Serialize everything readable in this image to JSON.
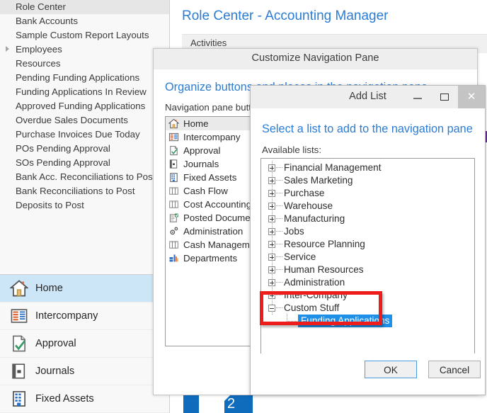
{
  "colors": {
    "accent_blue": "#2b7cd3",
    "selection_blue": "#1e90e8",
    "nav_active": "#cde6f7",
    "annotation_red": "#ef1c1c",
    "titlebar_gray": "#eeeeee",
    "tile_blue": "#0f6cbd"
  },
  "left_pane": {
    "activities": [
      {
        "label": "Role Center",
        "selected": true,
        "expander": false
      },
      {
        "label": "Bank Accounts",
        "selected": false,
        "expander": false
      },
      {
        "label": "Sample Custom Report Layouts",
        "selected": false,
        "expander": false
      },
      {
        "label": "Employees",
        "selected": false,
        "expander": true
      },
      {
        "label": "Resources",
        "selected": false,
        "expander": false
      },
      {
        "label": "Pending Funding Applications",
        "selected": false,
        "expander": false
      },
      {
        "label": "Funding Applications In Review",
        "selected": false,
        "expander": false
      },
      {
        "label": "Approved Funding Applications",
        "selected": false,
        "expander": false
      },
      {
        "label": "Overdue Sales Documents",
        "selected": false,
        "expander": false
      },
      {
        "label": "Purchase Invoices Due Today",
        "selected": false,
        "expander": false
      },
      {
        "label": "POs Pending Approval",
        "selected": false,
        "expander": false
      },
      {
        "label": "SOs Pending Approval",
        "selected": false,
        "expander": false
      },
      {
        "label": "Bank Acc. Reconciliations to Post",
        "selected": false,
        "expander": false
      },
      {
        "label": "Bank Reconciliations to Post",
        "selected": false,
        "expander": false
      },
      {
        "label": "Deposits to Post",
        "selected": false,
        "expander": false
      }
    ],
    "nav_buttons": [
      {
        "label": "Home",
        "icon": "home-icon",
        "active": true
      },
      {
        "label": "Intercompany",
        "icon": "intercompany-icon",
        "active": false
      },
      {
        "label": "Approval",
        "icon": "approval-icon",
        "active": false
      },
      {
        "label": "Journals",
        "icon": "journals-icon",
        "active": false
      },
      {
        "label": "Fixed Assets",
        "icon": "fixed-assets-icon",
        "active": false
      }
    ]
  },
  "role_center": {
    "title": "Role Center - Accounting Manager",
    "band_label": "Activities",
    "tile_number": "2"
  },
  "customize_dialog": {
    "title": "Customize Navigation Pane",
    "heading": "Organize buttons and places in the navigation pane",
    "list_label": "Navigation pane buttons:",
    "items": [
      {
        "label": "Home",
        "icon": "home-icon",
        "selected": true
      },
      {
        "label": "Intercompany",
        "icon": "intercompany-icon",
        "selected": false
      },
      {
        "label": "Approval",
        "icon": "approval-icon",
        "selected": false
      },
      {
        "label": "Journals",
        "icon": "journals-icon",
        "selected": false
      },
      {
        "label": "Fixed Assets",
        "icon": "fixed-assets-icon",
        "selected": false
      },
      {
        "label": "Cash Flow",
        "icon": "table-icon",
        "selected": false
      },
      {
        "label": "Cost Accounting",
        "icon": "table-icon",
        "selected": false
      },
      {
        "label": "Posted Document",
        "icon": "posted-document-icon",
        "selected": false
      },
      {
        "label": "Administration",
        "icon": "gear-icon",
        "selected": false
      },
      {
        "label": "Cash Management",
        "icon": "table-icon",
        "selected": false
      },
      {
        "label": "Departments",
        "icon": "departments-icon",
        "selected": false
      }
    ]
  },
  "add_list_dialog": {
    "title": "Add List",
    "heading": "Select a list to add to the navigation pane",
    "list_label": "Available lists:",
    "window_buttons": {
      "minimize": "minimize-button",
      "maximize": "maximize-button",
      "close": "✕"
    },
    "tree": [
      {
        "label": "Financial Management",
        "state": "collapsed",
        "level": 0
      },
      {
        "label": "Sales  Marketing",
        "state": "collapsed",
        "level": 0
      },
      {
        "label": "Purchase",
        "state": "collapsed",
        "level": 0
      },
      {
        "label": "Warehouse",
        "state": "collapsed",
        "level": 0
      },
      {
        "label": "Manufacturing",
        "state": "collapsed",
        "level": 0
      },
      {
        "label": "Jobs",
        "state": "collapsed",
        "level": 0
      },
      {
        "label": "Resource Planning",
        "state": "collapsed",
        "level": 0
      },
      {
        "label": "Service",
        "state": "collapsed",
        "level": 0
      },
      {
        "label": "Human Resources",
        "state": "collapsed",
        "level": 0
      },
      {
        "label": "Administration",
        "state": "collapsed",
        "level": 0
      },
      {
        "label": "Inter-Company",
        "state": "collapsed",
        "level": 0
      },
      {
        "label": "Custom Stuff",
        "state": "expanded",
        "level": 0
      },
      {
        "label": "Funding Applications",
        "state": "leaf",
        "level": 1,
        "selected": true
      }
    ],
    "buttons": {
      "ok": "OK",
      "cancel": "Cancel"
    }
  }
}
